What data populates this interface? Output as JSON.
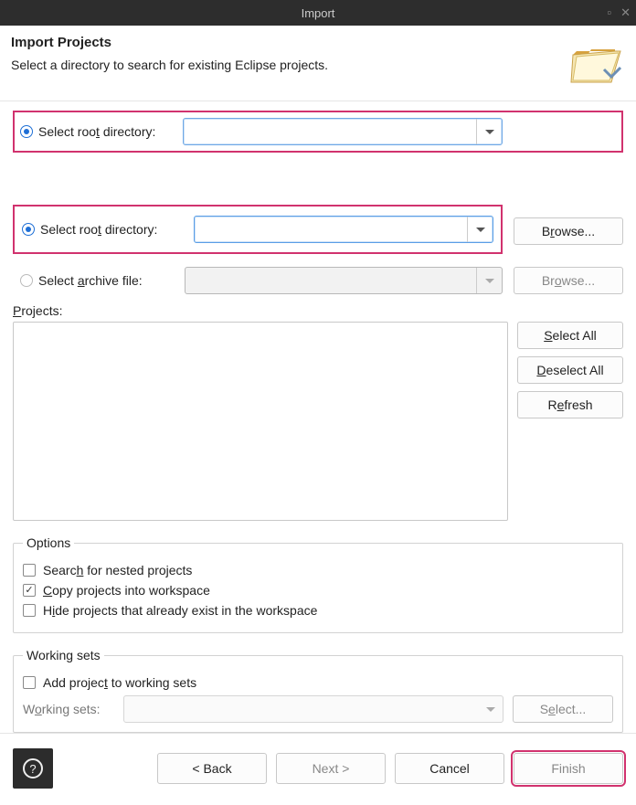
{
  "window": {
    "title": "Import"
  },
  "header": {
    "title": "Import Projects",
    "description": "Select a directory to search for existing Eclipse projects."
  },
  "source": {
    "rootDir": {
      "label_prefix": "Select roo",
      "label_u": "t",
      "label_suffix": " directory:",
      "value": "",
      "browse": "Browse..."
    },
    "archive": {
      "label_prefix": "Select ",
      "label_u": "a",
      "label_suffix": "rchive file:",
      "value": "",
      "browse": "Browse..."
    }
  },
  "projects": {
    "label_u": "P",
    "label_suffix": "rojects:",
    "buttons": {
      "selectAll_u": "S",
      "selectAll_rest": "elect All",
      "deselectAll_u": "D",
      "deselectAll_rest": "eselect All",
      "refresh_u": "e",
      "refresh_pre": "R",
      "refresh_post": "fresh"
    }
  },
  "options": {
    "legend": "Options",
    "nested": {
      "pre": "Searc",
      "u": "h",
      "post": " for nested projects",
      "checked": false
    },
    "copy": {
      "u": "C",
      "post": "opy projects into workspace",
      "checked": true
    },
    "hide": {
      "pre": "H",
      "u": "i",
      "post": "de projects that already exist in the workspace",
      "checked": false
    }
  },
  "workingSets": {
    "legend": "Working sets",
    "add": {
      "pre": "Add projec",
      "u": "t",
      "post": " to working sets",
      "checked": false
    },
    "label": {
      "pre": "W",
      "u": "o",
      "post": "rking sets:"
    },
    "select": {
      "pre": "S",
      "u": "e",
      "post": "lect..."
    }
  },
  "footer": {
    "back": "< Back",
    "next": "Next >",
    "cancel": "Cancel",
    "finish": "Finish"
  }
}
